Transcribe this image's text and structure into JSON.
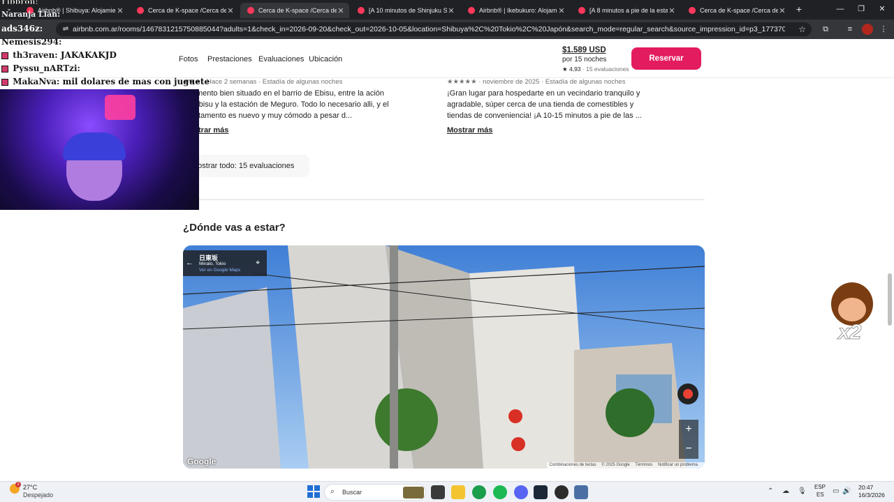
{
  "browser": {
    "tabs": [
      {
        "label": "Airbnb® | Shibuya: Alojamientos",
        "active": false
      },
      {
        "label": "Cerca de K-space /Cerca de Ebisu",
        "active": false
      },
      {
        "label": "Cerca de K-space /Cerca de Ebisu",
        "active": true
      },
      {
        "label": "[A 10 minutos de Shinjuku Station",
        "active": false
      },
      {
        "label": "Airbnb® | Ikebukuro: Alojamientos",
        "active": false
      },
      {
        "label": "[A 8 minutos a pie de la estación",
        "active": false
      },
      {
        "label": "Cerca de K-space /Cerca de Ebisu",
        "active": false
      }
    ],
    "url": "airbnb.com.ar/rooms/1467831215750885044?adults=1&check_in=2026-09-20&check_out=2026-10-05&location=Shibuya%2C%20Tokio%2C%20Japón&search_mode=regular_search&source_impression_id=p3_1773704735_P3sMuHy7rIffTnN&prev..."
  },
  "stream_chat": {
    "top_partial_1": "Fibbron:",
    "top_partial_2": "Naranja Lian:",
    "url_user": "ads346z:",
    "messages": [
      {
        "user": "Nemesis294:",
        "text": ""
      },
      {
        "user": "th3raven:",
        "text": "JAKAKAKJD"
      },
      {
        "user": "Pyssu_nARTzi:",
        "text": ""
      },
      {
        "user": "MakaNva:",
        "text": "mil dolares de mas con juguete"
      }
    ],
    "emote_multiplier": "x2"
  },
  "listing_nav": {
    "links": [
      "Fotos",
      "Prestaciones",
      "Evaluaciones",
      "Ubicación"
    ],
    "price": "$1.589 USD",
    "per_nights": "por 15 noches",
    "rating": "★ 4,93",
    "reviews_count": "15 evaluaciones",
    "reserve_label": "Reservar"
  },
  "reviews": [
    {
      "stars": "★★★",
      "date": "Hace 2 semanas",
      "stay": "Estadía de algunas noches",
      "text": "artamento bien situado en el barrio de Ebisu, entre la ación de Ebisu y la estación de Meguro. Todo lo necesario alli, y el apartamento es nuevo y muy cómodo a pesar d...",
      "show_more": "Mostrar más"
    },
    {
      "stars": "★★★★★",
      "date": "noviembre de 2025",
      "stay": "Estadía de algunas noches",
      "text": "¡Gran lugar para hospedarte en un vecindario tranquilo y agradable, súper cerca de una tienda de comestibles y tiendas de conveniencia! ¡A 10-15 minutos a pie de las ...",
      "show_more": "Mostrar más"
    }
  ],
  "show_all_label": "Mostrar todo: 15 evaluaciones",
  "where_title": "¿Dónde vas a estar?",
  "street_view": {
    "place": "日東坂",
    "subtitle": "Minato, Tokio",
    "link": "Ver en Google Maps",
    "logo": "Google",
    "attribution": [
      "Combinaciones de teclas",
      "© 2025 Google",
      "Términos",
      "Notificar un problema"
    ],
    "zoom_in": "+",
    "zoom_out": "−"
  },
  "taskbar": {
    "temperature": "27°C",
    "condition": "Despejado",
    "search_placeholder": "Buscar",
    "lang_1": "ESP",
    "lang_2": "ES",
    "time": "20:47",
    "date": "16/3/2026",
    "weather_badge": "1"
  },
  "colors": {
    "airbnb_accent": "#e31c5f",
    "tab_bg": "#202124",
    "active_tab_bg": "#35363a"
  }
}
